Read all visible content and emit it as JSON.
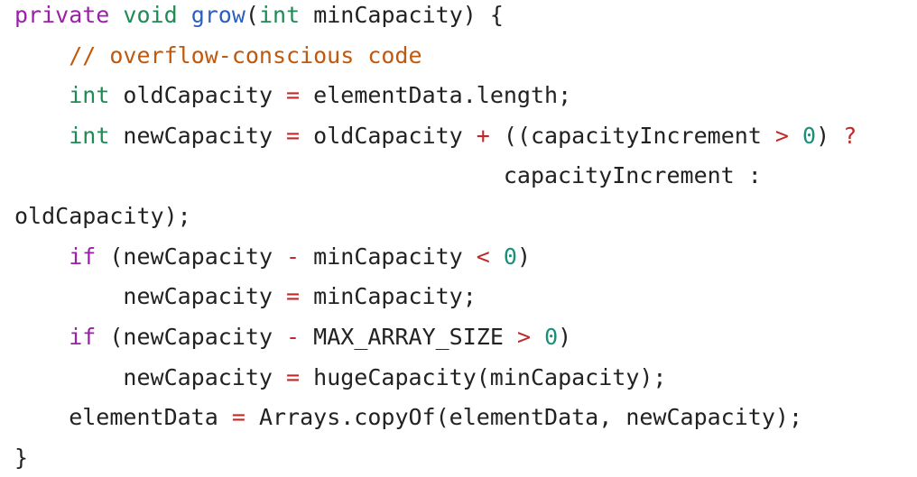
{
  "lines": [
    {
      "tokens": [
        {
          "text": "private",
          "type": "kw-purple"
        },
        {
          "text": " ",
          "type": "plain"
        },
        {
          "text": "void",
          "type": "kw-green"
        },
        {
          "text": " ",
          "type": "plain"
        },
        {
          "text": "grow",
          "type": "kw-blue"
        },
        {
          "text": "(",
          "type": "plain"
        },
        {
          "text": "int",
          "type": "kw-green"
        },
        {
          "text": " minCapacity) {",
          "type": "plain"
        }
      ]
    },
    {
      "tokens": [
        {
          "text": "    // overflow-conscious code",
          "type": "comment"
        }
      ]
    },
    {
      "tokens": [
        {
          "text": "    ",
          "type": "plain"
        },
        {
          "text": "int",
          "type": "kw-green"
        },
        {
          "text": " oldCapacity ",
          "type": "plain"
        },
        {
          "text": "=",
          "type": "op"
        },
        {
          "text": " elementData.length;",
          "type": "plain"
        }
      ]
    },
    {
      "tokens": [
        {
          "text": "    ",
          "type": "plain"
        },
        {
          "text": "int",
          "type": "kw-green"
        },
        {
          "text": " newCapacity ",
          "type": "plain"
        },
        {
          "text": "=",
          "type": "op"
        },
        {
          "text": " oldCapacity ",
          "type": "plain"
        },
        {
          "text": "+",
          "type": "op"
        },
        {
          "text": " ((capacityIncrement ",
          "type": "plain"
        },
        {
          "text": ">",
          "type": "op"
        },
        {
          "text": " ",
          "type": "plain"
        },
        {
          "text": "0",
          "type": "num"
        },
        {
          "text": ") ",
          "type": "plain"
        },
        {
          "text": "?",
          "type": "op"
        }
      ]
    },
    {
      "tokens": [
        {
          "text": "                                    capacityIncrement :",
          "type": "plain"
        }
      ]
    },
    {
      "tokens": [
        {
          "text": "oldCapacity);",
          "type": "plain"
        }
      ]
    },
    {
      "tokens": [
        {
          "text": "    ",
          "type": "plain"
        },
        {
          "text": "if",
          "type": "kw-purple"
        },
        {
          "text": " (newCapacity ",
          "type": "plain"
        },
        {
          "text": "-",
          "type": "op"
        },
        {
          "text": " minCapacity ",
          "type": "plain"
        },
        {
          "text": "<",
          "type": "op"
        },
        {
          "text": " ",
          "type": "plain"
        },
        {
          "text": "0",
          "type": "num"
        },
        {
          "text": ")",
          "type": "plain"
        }
      ]
    },
    {
      "tokens": [
        {
          "text": "        newCapacity ",
          "type": "plain"
        },
        {
          "text": "=",
          "type": "op"
        },
        {
          "text": " minCapacity;",
          "type": "plain"
        }
      ]
    },
    {
      "tokens": [
        {
          "text": "    ",
          "type": "plain"
        },
        {
          "text": "if",
          "type": "kw-purple"
        },
        {
          "text": " (newCapacity ",
          "type": "plain"
        },
        {
          "text": "-",
          "type": "op"
        },
        {
          "text": " MAX_ARRAY_SIZE ",
          "type": "plain"
        },
        {
          "text": ">",
          "type": "op"
        },
        {
          "text": " ",
          "type": "plain"
        },
        {
          "text": "0",
          "type": "num"
        },
        {
          "text": ")",
          "type": "plain"
        }
      ]
    },
    {
      "tokens": [
        {
          "text": "        newCapacity ",
          "type": "plain"
        },
        {
          "text": "=",
          "type": "op"
        },
        {
          "text": " hugeCapacity(minCapacity);",
          "type": "plain"
        }
      ]
    },
    {
      "tokens": [
        {
          "text": "    elementData ",
          "type": "plain"
        },
        {
          "text": "=",
          "type": "op"
        },
        {
          "text": " Arrays.copyOf(elementData, newCapacity);",
          "type": "plain"
        }
      ]
    },
    {
      "tokens": [
        {
          "text": "}",
          "type": "plain"
        }
      ]
    }
  ]
}
